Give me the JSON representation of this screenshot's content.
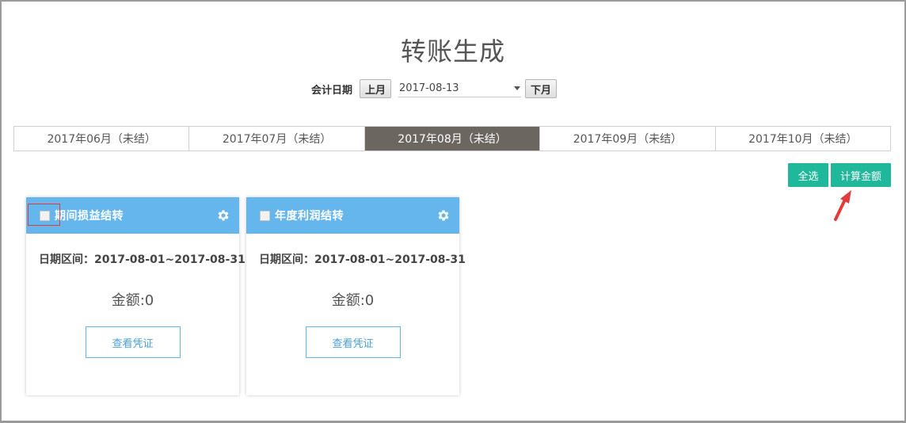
{
  "page": {
    "title": "转账生成"
  },
  "date_picker": {
    "label": "会计日期",
    "prev_label": "上月",
    "value": "2017-08-13",
    "next_label": "下月"
  },
  "period_tabs": [
    {
      "label": "2017年06月（未结）",
      "active": false
    },
    {
      "label": "2017年07月（未结）",
      "active": false
    },
    {
      "label": "2017年08月（未结）",
      "active": true
    },
    {
      "label": "2017年09月（未结）",
      "active": false
    },
    {
      "label": "2017年10月（未结）",
      "active": false
    }
  ],
  "actions": {
    "select_all_label": "全选",
    "calculate_label": "计算金额"
  },
  "cards": [
    {
      "title": "期间损益结转",
      "date_range": "日期区间：2017-08-01~2017-08-31",
      "amount": "金额:0",
      "voucher_label": "查看凭证",
      "checked": false
    },
    {
      "title": "年度利润结转",
      "date_range": "日期区间：2017-08-01~2017-08-31",
      "amount": "金额:0",
      "voucher_label": "查看凭证",
      "checked": false
    }
  ],
  "colors": {
    "accent_green": "#1fb89a",
    "card_header_blue": "#66b6ee",
    "active_tab": "#6b6660",
    "annotation_red": "#e23b3b"
  },
  "icons": {
    "gear": "gear-icon",
    "caret": "chevron-down-icon",
    "annotation": "red-arrow-icon"
  }
}
